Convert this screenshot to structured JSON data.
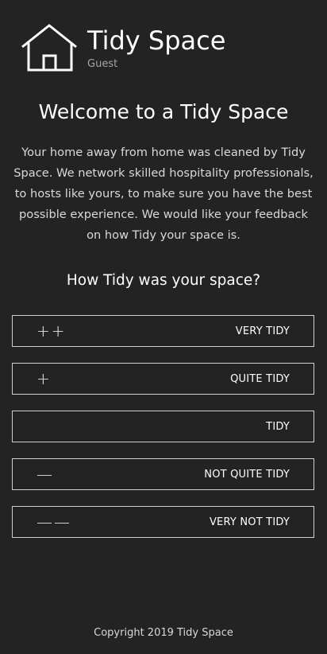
{
  "brand": {
    "name": "Tidy Space",
    "role": "Guest",
    "logo_icon": "house-icon"
  },
  "main": {
    "title": "Welcome to a Tidy Space",
    "intro": "Your home away from home was cleaned by Tidy Space. We network skilled hospitality professionals, to hosts like yours, to make sure you have the best possible experience. We would like your feedback on how Tidy your space is.",
    "question": "How Tidy was your space?"
  },
  "options": [
    {
      "symbol": "++",
      "label": "VERY TIDY"
    },
    {
      "symbol": "+",
      "label": "QUITE TIDY"
    },
    {
      "symbol": "",
      "label": "TIDY"
    },
    {
      "symbol": "—",
      "label": "NOT QUITE TIDY"
    },
    {
      "symbol": "——",
      "label": "VERY NOT TIDY"
    }
  ],
  "footer": {
    "copyright": "Copyright 2019 Tidy Space"
  },
  "colors": {
    "background": "#232323",
    "text": "#ffffff",
    "muted": "#a6a6a6",
    "border": "#cfcfcf"
  }
}
